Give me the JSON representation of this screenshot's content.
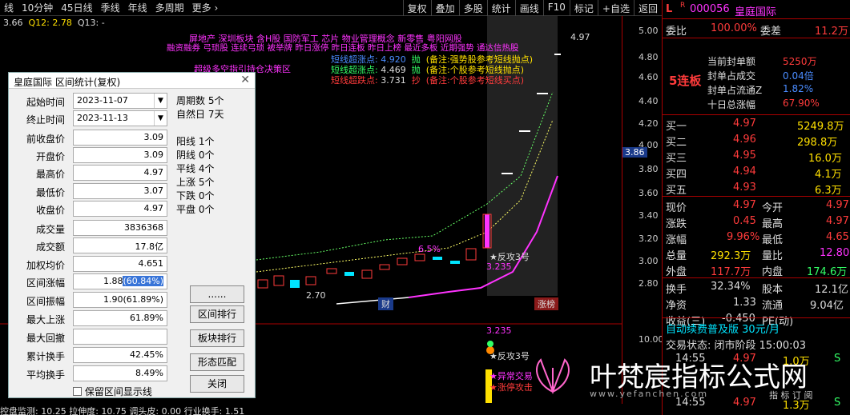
{
  "topbar": {
    "tabs": [
      "线",
      "10分钟",
      "45日线",
      "季线",
      "年线",
      "多周期",
      "更多 ›"
    ],
    "right": [
      "复权",
      "叠加",
      "多股",
      "统计",
      "画线",
      "F10",
      "标记",
      "+自选",
      "返回"
    ]
  },
  "info": {
    "first": "3.66",
    "q12": "Q12: 2.78",
    "q13": "Q13: -"
  },
  "chart_text": {
    "line1": "屏地产    深圳板块  含H股 国防军工 芯片 物业管理概念 新零售 粤阳网股",
    "line2": "融资融券 弓琐股 连续弓琐 被举牌 昨日涨停 昨日连板 昨日上榜 最近多板 近期强势 通达信热股",
    "line3": "超级多空指引持仓决策区",
    "s1_label": "短线超涨点:",
    "s1_val": "4.920",
    "s1_tag": "抛",
    "s1_note": "(备注:强势股参考短线抛点)",
    "s2_label": "短线超涨点:",
    "s2_val": "4.469",
    "s2_tag": "抛",
    "s2_note": "(备注:个股参考短线抛点)",
    "s3_label": "短线超跌点:",
    "s3_val": "3.731",
    "s3_tag": "抄",
    "s3_note": "(备注:个股参考短线买点)",
    "high": "4.97",
    "low": "2.70",
    "pct": "6.5%",
    "fg": "★反攻3号",
    "fgval": "3.235",
    "cai": "财",
    "zb": "涨榜",
    "sub_val": "3.235",
    "sub_fg": "★反攻3号",
    "sub_yc": "★异常交易",
    "sub_zt": "★涨停攻击",
    "sub_axis": "10.00"
  },
  "yaxis": {
    "labels": [
      "5.00",
      "4.80",
      "4.60",
      "4.40",
      "4.20",
      "4.00",
      "3.80",
      "3.60",
      "3.40",
      "3.20",
      "3.00",
      "2.80"
    ],
    "current": "3.86"
  },
  "dialog": {
    "title": "皇庭国际 区间统计(复权)",
    "start_label": "起始时间",
    "start": "2023-11-07",
    "end_label": "终止时间",
    "end": "2023-11-13",
    "rows": [
      {
        "label": "前收盘价",
        "value": "3.09"
      },
      {
        "label": "开盘价",
        "value": "3.09"
      },
      {
        "label": "最高价",
        "value": "4.97"
      },
      {
        "label": "最低价",
        "value": "3.07"
      },
      {
        "label": "收盘价",
        "value": "4.97"
      },
      {
        "label": "成交量",
        "value": "3836368"
      },
      {
        "label": "成交额",
        "value": "17.8亿"
      },
      {
        "label": "加权均价",
        "value": "4.651"
      }
    ],
    "zf_label": "区间涨幅",
    "zf_a": "1.88",
    "zf_b": "(60.84%)",
    "rows2": [
      {
        "label": "区间振幅",
        "value": "1.90(61.89%)"
      },
      {
        "label": "最大上涨",
        "value": "61.89%"
      },
      {
        "label": "最大回撤",
        "value": ""
      },
      {
        "label": "累计换手",
        "value": "42.45%"
      },
      {
        "label": "平均换手",
        "value": "8.49%"
      }
    ],
    "stats": {
      "periods": "周期数 5个",
      "natural": "自然日 7天",
      "yang": "阳线 1个",
      "yin": "阴线 0个",
      "ping": "平线 4个",
      "up": "上涨 5个",
      "down": "下跌 0个",
      "flat": "平盘 0个"
    },
    "buttons": [
      "......",
      "区间排行",
      "板块排行",
      "形态匹配",
      "关闭"
    ],
    "checkbox": "保留区间显示线"
  },
  "right": {
    "code": "000056",
    "name": "皇庭国际",
    "L": "L",
    "R": "R",
    "webi": "委比",
    "webi_v": "100.00%",
    "wecha": "委差",
    "wecha_v": "11.2万",
    "lb": "5连板",
    "f1": "当前封单额",
    "f1v": "5250万",
    "f2": "封单占成交",
    "f2v": "0.04倍",
    "f3": "封单占流通Z",
    "f3v": "1.82%",
    "f4": "十日总涨幅",
    "f4v": "67.90%",
    "buys": [
      {
        "l": "买一",
        "p": "4.97",
        "v": "5249.8万"
      },
      {
        "l": "买二",
        "p": "4.96",
        "v": "298.8万"
      },
      {
        "l": "买三",
        "p": "4.95",
        "v": "16.0万"
      },
      {
        "l": "买四",
        "p": "4.94",
        "v": "4.1万"
      },
      {
        "l": "买五",
        "p": "4.93",
        "v": "6.3万"
      }
    ],
    "q": [
      {
        "a": "现价",
        "av": "4.97",
        "b": "今开",
        "bv": "4.97"
      },
      {
        "a": "涨跌",
        "av": "0.45",
        "b": "最高",
        "bv": "4.97"
      },
      {
        "a": "涨幅",
        "av": "9.96%",
        "b": "最低",
        "bv": "4.65"
      },
      {
        "a": "总量",
        "av": "292.3万",
        "b": "量比",
        "bv": "12.80"
      },
      {
        "a": "外盘",
        "av": "117.7万",
        "b": "内盘",
        "bv": "174.6万"
      }
    ],
    "q2": [
      {
        "a": "换手",
        "av": "32.34%",
        "b": "股本",
        "bv": "12.1亿"
      },
      {
        "a": "净资",
        "av": "1.33",
        "b": "流通",
        "bv": "9.04亿"
      },
      {
        "a": "收益(三)",
        "av": "-0.450",
        "b": "PE(动)",
        "bv": ""
      }
    ],
    "ad": "自动续费普及版 30元/月",
    "status": "交易状态: 闭市阶段 15:00:03",
    "ticks": [
      {
        "t": "14:55",
        "p": "4.97",
        "v": "1.0万",
        "f": "S"
      },
      {
        "t": "14:55",
        "p": "4.97",
        "v": "1.3万",
        "f": "S"
      }
    ]
  },
  "bottom": "控盘监测: 10.25  拉伸度: 10.75  调头皮: 0.00  行业换手: 1.51",
  "watermark": {
    "text": "叶梵宸指标公式网",
    "url": "www.yefanchen.com",
    "sub": "指 标 订 阅"
  }
}
